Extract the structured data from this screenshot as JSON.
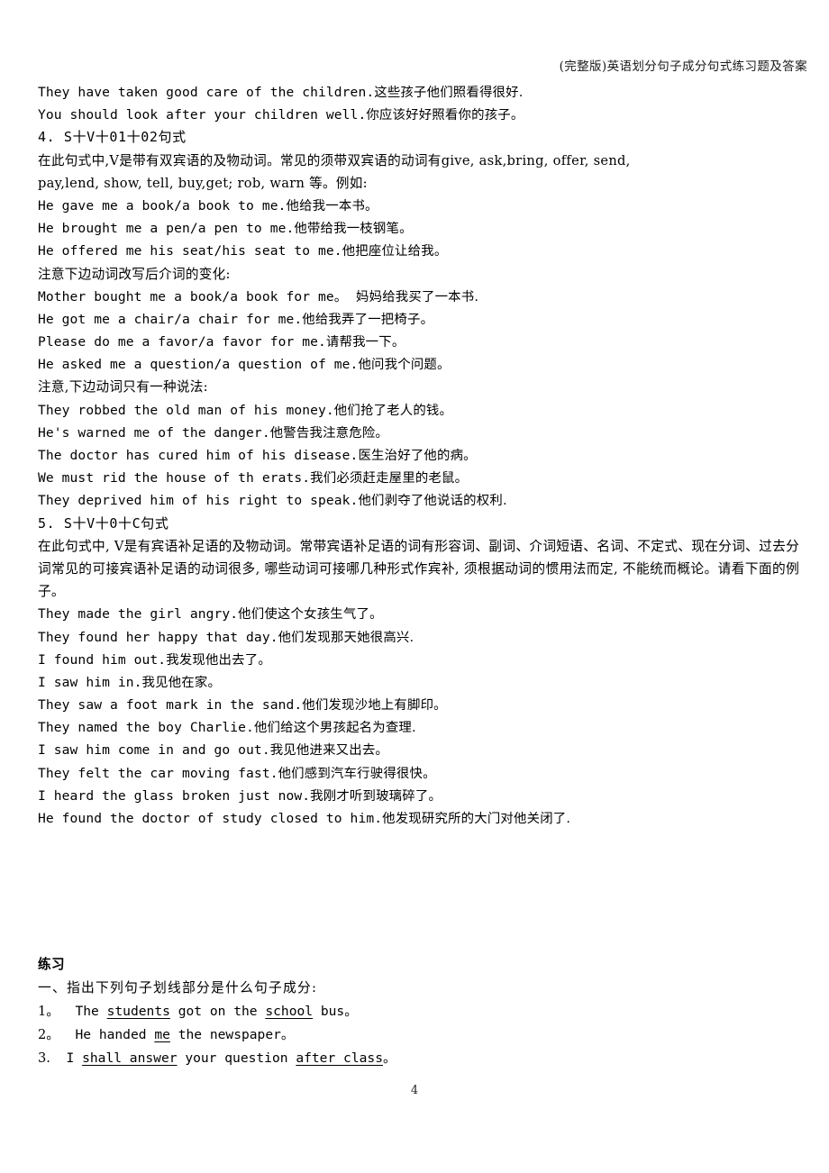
{
  "header": {
    "running_title": "(完整版)英语划分句子成分句式练习题及答案"
  },
  "page_number": "4",
  "body_lines": [
    {
      "kind": "en",
      "en": "They have taken good care of the children.",
      "cn": "这些孩子他们照看得很好."
    },
    {
      "kind": "en",
      "en": "You should look after your children well.",
      "cn": "你应该好好照看你的孩子。"
    },
    {
      "kind": "heading",
      "text": "4. S十V十01十02句式",
      "latin": "4. S",
      "cn_sep1": "十",
      "latin2": "V",
      "cn_sep2": "十",
      "latin3": "01",
      "cn_sep3": "十",
      "latin4": "02",
      "cn_tail": "句式"
    },
    {
      "kind": "para2",
      "line1": "在此句式中,V是带有双宾语的及物动词。常见的须带双宾语的动词有give, ask,bring, offer, send,",
      "line2": "pay,lend, show, tell, buy,get; rob, warn 等。例如:"
    },
    {
      "kind": "en",
      "en": "He gave me a book/a book to me.",
      "cn": "他给我一本书。"
    },
    {
      "kind": "en",
      "en": "He brought me a pen/a pen to me.",
      "cn": "他带给我一枝钢笔。"
    },
    {
      "kind": "en",
      "en": "He offered me his seat/his seat to me.",
      "cn": "他把座位让给我。"
    },
    {
      "kind": "zh",
      "text": "注意下边动词改写后介词的变化:"
    },
    {
      "kind": "en",
      "en": "Mother bought me a book/a book for me。",
      "cn": "  妈妈给我买了一本书."
    },
    {
      "kind": "en",
      "en": "He got me a chair/a chair for me.",
      "cn": "他给我弄了一把椅子。"
    },
    {
      "kind": "en",
      "en": "Please do me a favor/a favor for me.",
      "cn": "请帮我一下。"
    },
    {
      "kind": "en",
      "en": "He asked me a question/a question of me.",
      "cn": "他问我个问题。"
    },
    {
      "kind": "zh",
      "text": "注意,下边动词只有一种说法:"
    },
    {
      "kind": "en",
      "en": "They robbed the old man of his money.",
      "cn": "他们抢了老人的钱。"
    },
    {
      "kind": "en",
      "en": "He's warned me of the danger.",
      "cn": "他警告我注意危险。"
    },
    {
      "kind": "en",
      "en": "The doctor has cured him of his disease.",
      "cn": "医生治好了他的病。"
    },
    {
      "kind": "en",
      "en": "We must rid the house of th erats.",
      "cn": "我们必须赶走屋里的老鼠。"
    },
    {
      "kind": "en",
      "en": "They deprived him of his right to speak.",
      "cn": "他们剥夺了他说话的权利."
    },
    {
      "kind": "heading5",
      "text": "5. S十V十0十C句式"
    },
    {
      "kind": "para3",
      "text": "在此句式中, V是有宾语补足语的及物动词。常带宾语补足语的词有形容词、副词、介词短语、名词、不定式、现在分词、过去分词常见的可接宾语补足语的动词很多, 哪些动词可接哪几种形式作宾补, 须根据动词的惯用法而定, 不能统而概论。请看下面的例子。"
    },
    {
      "kind": "en",
      "en": "They made the girl angry.",
      "cn": "他们使这个女孩生气了。"
    },
    {
      "kind": "en",
      "en": "They found her happy that day.",
      "cn": "他们发现那天她很高兴."
    },
    {
      "kind": "en",
      "en": "I found him out.",
      "cn": "我发现他出去了。"
    },
    {
      "kind": "en",
      "en": "I saw him in.",
      "cn": "我见他在家。"
    },
    {
      "kind": "en",
      "en": "They saw a foot mark in the sand.",
      "cn": "他们发现沙地上有脚印。"
    },
    {
      "kind": "en",
      "en": "They named the boy Charlie.",
      "cn": "他们给这个男孩起名为查理."
    },
    {
      "kind": "en",
      "en": "I saw him come in and go out.",
      "cn": "我见他进来又出去。"
    },
    {
      "kind": "en",
      "en": "They felt the car moving fast.",
      "cn": "他们感到汽车行驶得很快。"
    },
    {
      "kind": "en",
      "en": "I heard the glass broken just now.",
      "cn": "我刚才听到玻璃碎了。"
    },
    {
      "kind": "en",
      "en": "He found the doctor of study closed to him.",
      "cn": "他发现研究所的大门对他关闭了."
    }
  ],
  "exercise": {
    "title": "练习",
    "instruction": "一、指出下列句子划线部分是什么句子成分:",
    "items": [
      {
        "num": "1。",
        "pre": "  The ",
        "u1": "students",
        "mid": " got on the ",
        "u2": "school",
        "post": " bus",
        "end": "。"
      },
      {
        "num": "2。",
        "pre": "  He handed ",
        "u1": "me",
        "mid": " the newspaper",
        "u2": "",
        "post": "",
        "end": "。"
      },
      {
        "num": "3.",
        "pre": "  I ",
        "u1": "shall answer",
        "mid": " your question ",
        "u2": "after class",
        "post": "",
        "end": "。"
      }
    ]
  }
}
